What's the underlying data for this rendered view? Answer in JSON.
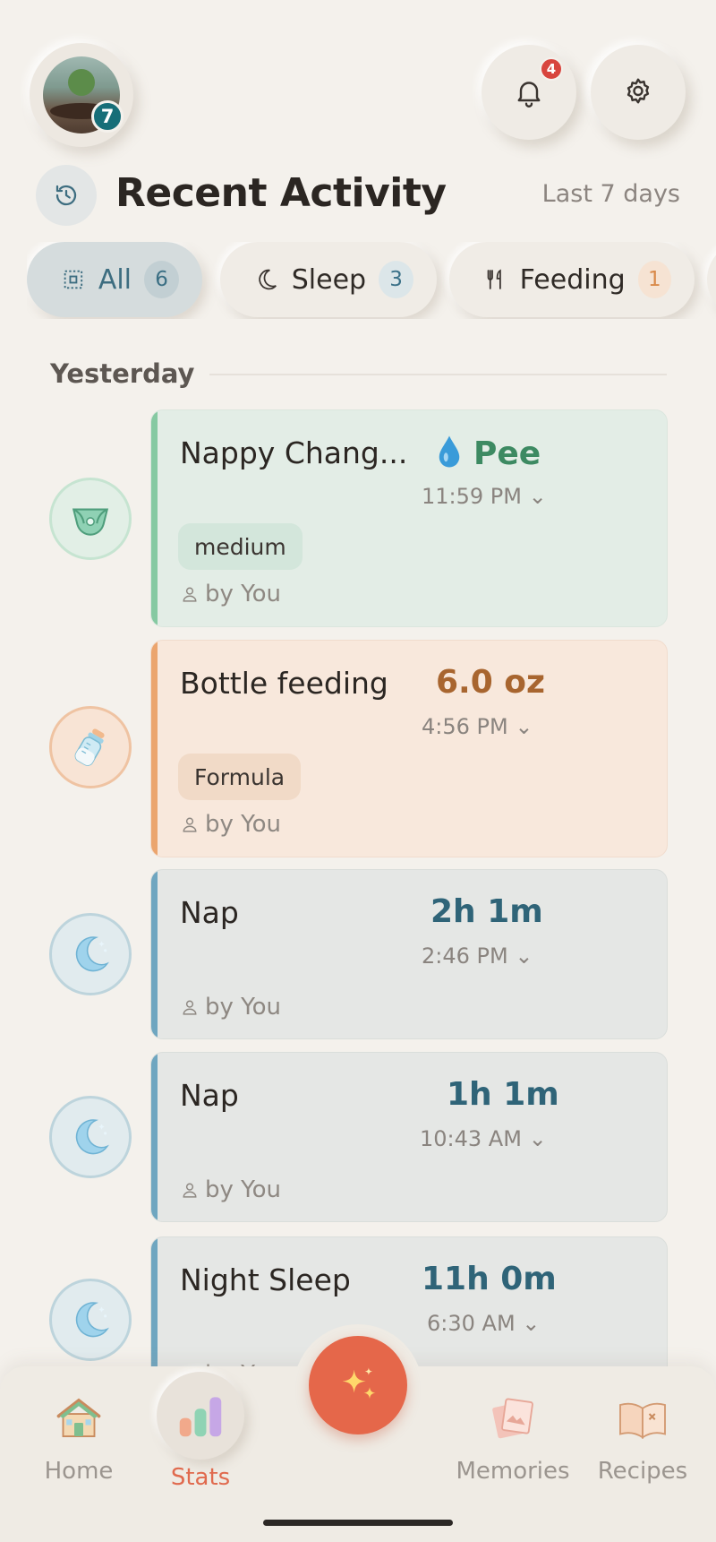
{
  "header": {
    "avatar_badge": "7",
    "notification_count": "4"
  },
  "title": "Recent Activity",
  "period": "Last 7 days",
  "filters": [
    {
      "label": "All",
      "count": "6"
    },
    {
      "label": "Sleep",
      "count": "3"
    },
    {
      "label": "Feeding",
      "count": "1"
    }
  ],
  "section": "Yesterday",
  "activities": [
    {
      "name": "Nappy Chang...",
      "metric": "Pee",
      "metric_icon": "droplet-icon",
      "time": "11:59 PM",
      "tag": "medium",
      "by": "by You",
      "icon": "diaper-icon",
      "color": "#86c9a2"
    },
    {
      "name": "Bottle feeding",
      "metric": "6.0 oz",
      "time": "4:56 PM",
      "tag": "Formula",
      "by": "by You",
      "icon": "bottle-icon",
      "color": "#eba56e"
    },
    {
      "name": "Nap",
      "metric": "2h 1m",
      "time": "2:46 PM",
      "by": "by You",
      "icon": "moon-icon",
      "color": "#6fa6c0"
    },
    {
      "name": "Nap",
      "metric": "1h 1m",
      "time": "10:43 AM",
      "by": "by You",
      "icon": "moon-icon",
      "color": "#6fa6c0"
    },
    {
      "name": "Night Sleep",
      "metric": "11h 0m",
      "time": "6:30 AM",
      "by": "by You",
      "icon": "moon-icon",
      "color": "#6fa6c0"
    }
  ],
  "nav": {
    "home": "Home",
    "stats": "Stats",
    "memories": "Memories",
    "recipes": "Recipes"
  },
  "colors": {
    "accent": "#e5674a",
    "nappy": "#3d8a62",
    "feeding": "#a8652f",
    "sleep": "#2f6478"
  }
}
